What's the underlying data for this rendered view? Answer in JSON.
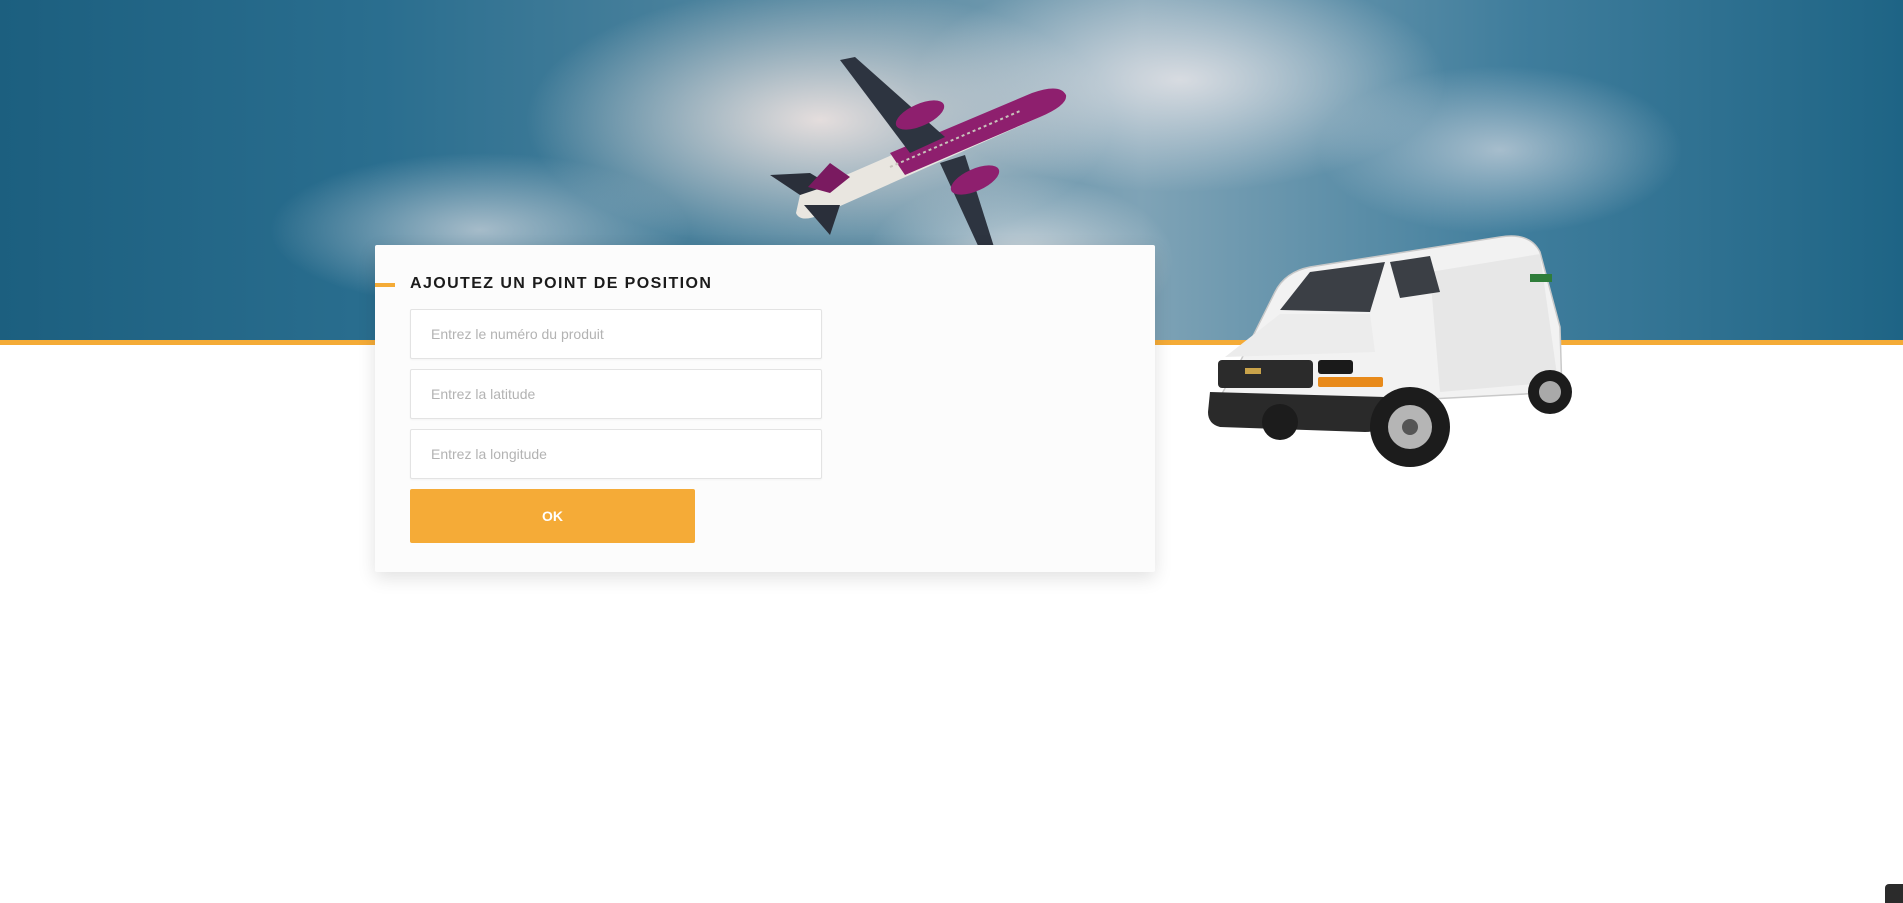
{
  "form": {
    "title": "AJOUTEZ UN POINT DE POSITION",
    "fields": [
      {
        "placeholder": "Entrez le numéro du produit",
        "value": ""
      },
      {
        "placeholder": "Entrez la latitude",
        "value": ""
      },
      {
        "placeholder": "Entrez la longitude",
        "value": ""
      }
    ],
    "submit_label": "OK"
  },
  "colors": {
    "accent": "#f4ab37",
    "button": "#f5ab37",
    "sky_dark": "#1c5f7f",
    "title_text": "#1b1b1b"
  },
  "icons": {
    "hero_image": "airplane-in-sky",
    "side_image": "white-cargo-van"
  }
}
